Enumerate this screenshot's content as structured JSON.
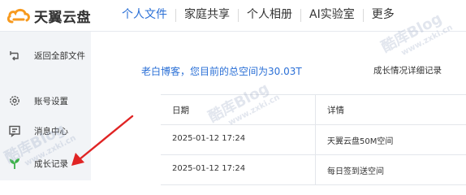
{
  "app": {
    "logo_text": "天翼云盘"
  },
  "nav": {
    "items": [
      {
        "label": "个人文件",
        "active": true
      },
      {
        "label": "家庭共享",
        "active": false
      },
      {
        "label": "个人相册",
        "active": false
      },
      {
        "label": "AI实验室",
        "active": false
      },
      {
        "label": "更多",
        "active": false
      }
    ]
  },
  "sidebar": {
    "items": [
      {
        "label": "返回全部文件",
        "icon": "back-icon"
      },
      {
        "label": "账号设置",
        "icon": "gear-icon"
      },
      {
        "label": "消息中心",
        "icon": "message-icon"
      },
      {
        "label": "成长记录",
        "icon": "growth-sprout-icon"
      }
    ]
  },
  "main": {
    "summary": "老白博客，您目前的总空间为30.03T",
    "detail_link": "成长情况详细记录"
  },
  "table": {
    "headers": [
      "日期",
      "详情"
    ],
    "rows": [
      [
        "2025-01-12 17:24",
        "天翼云盘50M空间"
      ],
      [
        "2025-01-12 17:24",
        "每日签到送空间"
      ]
    ]
  },
  "watermark": {
    "text": "酷库Blog",
    "url": "www.zxki.cn"
  },
  "colors": {
    "accent": "#2a6fd6",
    "sidebar_bg": "#f2f4f7",
    "logo_orange": "#f79a1e",
    "arrow_red": "#e02424",
    "sprout_green": "#3cb24a"
  }
}
